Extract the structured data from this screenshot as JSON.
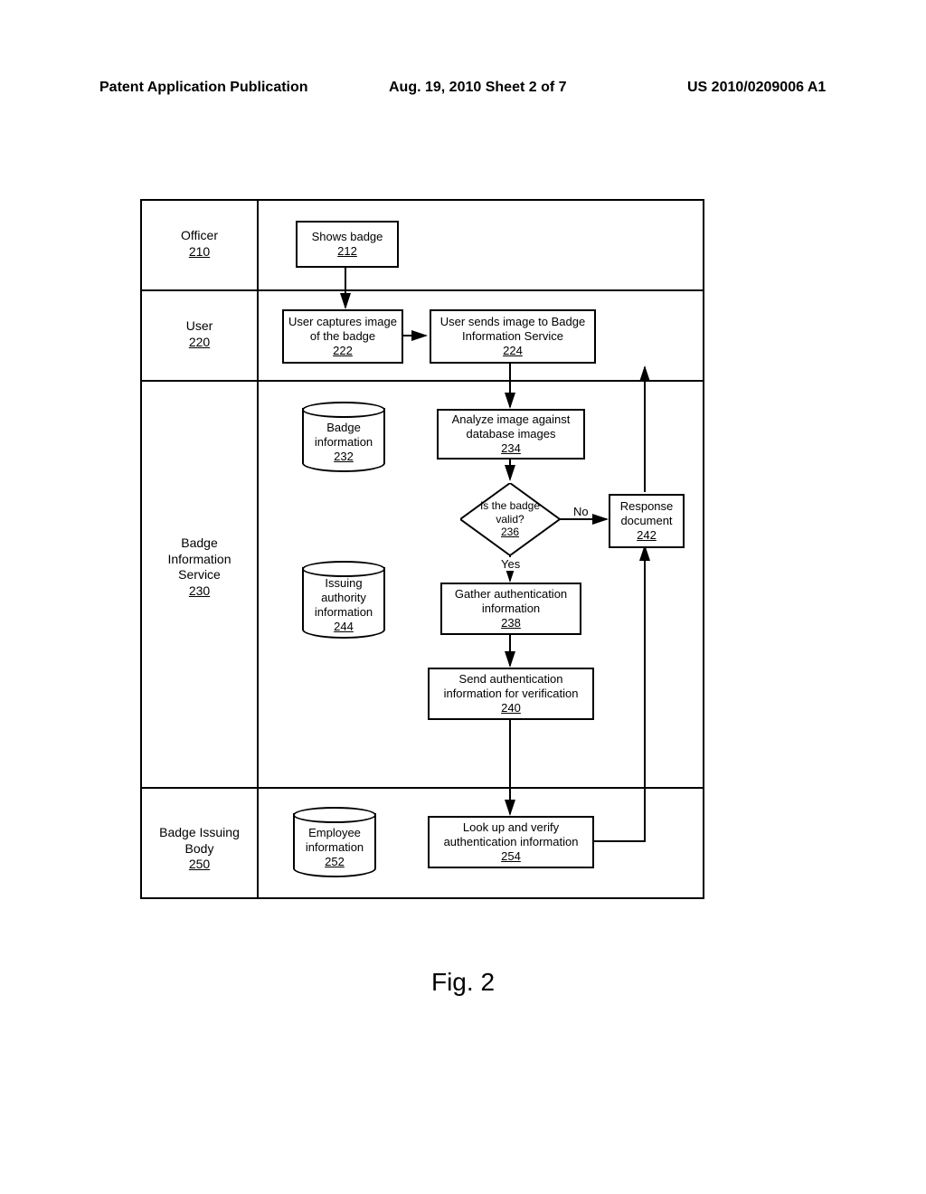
{
  "header": {
    "left": "Patent Application Publication",
    "center": "Aug. 19, 2010  Sheet 2 of 7",
    "right": "US 2010/0209006 A1"
  },
  "figure_caption": "Fig. 2",
  "lanes": {
    "officer": {
      "title": "Officer",
      "ref": "210"
    },
    "user": {
      "title": "User",
      "ref": "220"
    },
    "service": {
      "title": "Badge Information Service",
      "ref": "230"
    },
    "issuer": {
      "title": "Badge Issuing Body",
      "ref": "250"
    }
  },
  "nodes": {
    "shows_badge": {
      "text": "Shows badge",
      "ref": "212"
    },
    "capture": {
      "text": "User captures image of the badge",
      "ref": "222"
    },
    "send_image": {
      "text": "User sends image to Badge Information Service",
      "ref": "224"
    },
    "badge_info_db": {
      "text": "Badge information",
      "ref": "232"
    },
    "analyze": {
      "text": "Analyze image against database images",
      "ref": "234"
    },
    "decision": {
      "text": "Is the badge valid?",
      "ref": "236"
    },
    "gather": {
      "text": "Gather authentication information",
      "ref": "238"
    },
    "send_auth": {
      "text": "Send authentication information for verification",
      "ref": "240"
    },
    "response_doc": {
      "text": "Response document",
      "ref": "242"
    },
    "issuing_db": {
      "text": "Issuing authority information",
      "ref": "244"
    },
    "employee_db": {
      "text": "Employee information",
      "ref": "252"
    },
    "lookup": {
      "text": "Look up and verify authentication information",
      "ref": "254"
    }
  },
  "edge_labels": {
    "yes": "Yes",
    "no": "No"
  }
}
